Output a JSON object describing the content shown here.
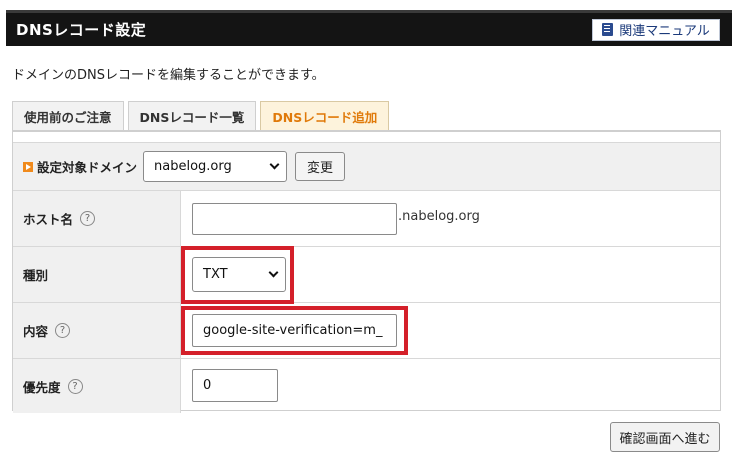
{
  "header": {
    "title": "DNSレコード設定",
    "manual_label": "関連マニュアル"
  },
  "description": "ドメインのDNSレコードを編集することができます。",
  "tabs": [
    {
      "label": "使用前のご注意",
      "active": false
    },
    {
      "label": "DNSレコード一覧",
      "active": false
    },
    {
      "label": "DNSレコード追加",
      "active": true
    }
  ],
  "domain_select": {
    "label": "設定対象ドメイン",
    "value": "nabelog.org",
    "button": "変更"
  },
  "form": {
    "host": {
      "label": "ホスト名",
      "value": "",
      "suffix": ".nabelog.org",
      "help": "?"
    },
    "type": {
      "label": "種別",
      "value": "TXT"
    },
    "content": {
      "label": "内容",
      "value": "google-site-verification=m_",
      "help": "?"
    },
    "priority": {
      "label": "優先度",
      "value": "0",
      "help": "?"
    }
  },
  "confirm_button": "確認画面へ進む",
  "colors": {
    "accent_tab": "#e07a0a",
    "highlight": "#d4202a",
    "header_bg": "#141414"
  }
}
